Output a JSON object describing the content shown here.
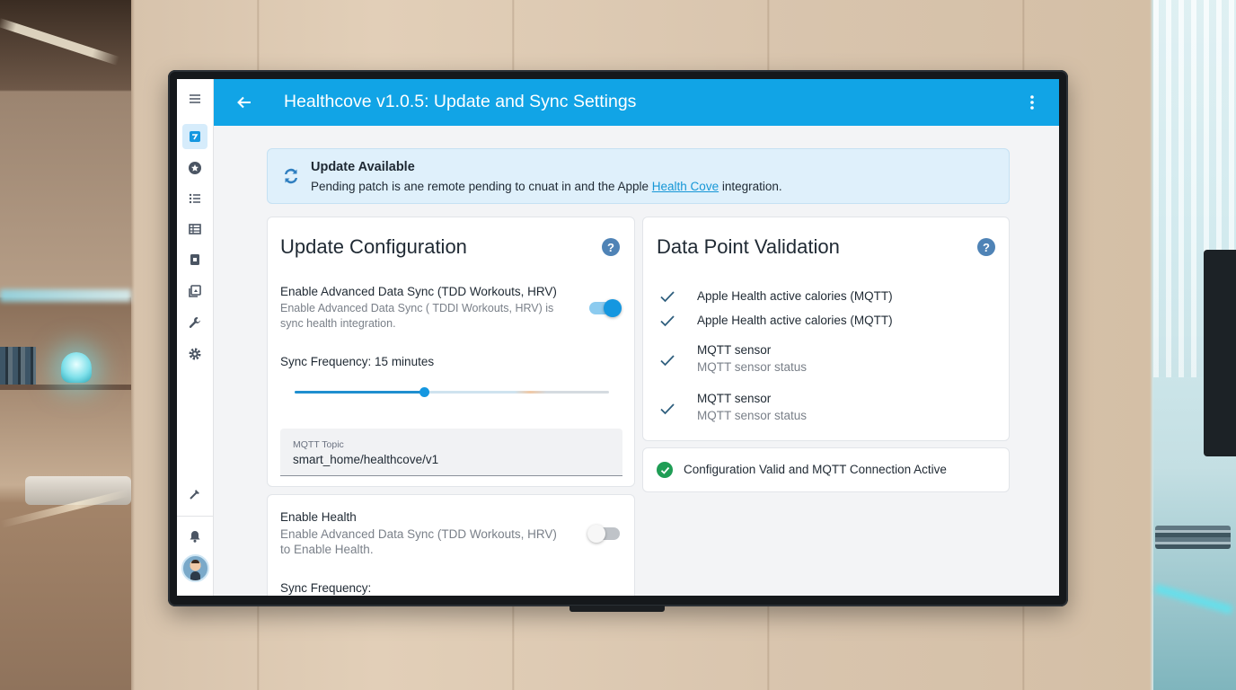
{
  "app": {
    "title": "Healthcove v1.0.5: Update and Sync Settings"
  },
  "sidebar": {
    "items": [
      {
        "icon": "menu-icon"
      },
      {
        "icon": "dashboard-icon",
        "active": true
      },
      {
        "icon": "star-badge-icon"
      },
      {
        "icon": "list-icon"
      },
      {
        "icon": "table-icon"
      },
      {
        "icon": "device-icon"
      },
      {
        "icon": "media-icon"
      },
      {
        "icon": "wrench-icon"
      },
      {
        "icon": "gear-icon"
      },
      {
        "icon": "hammer-icon"
      },
      {
        "icon": "bell-icon"
      },
      {
        "icon": "avatar"
      }
    ]
  },
  "banner": {
    "title": "Update Available",
    "text_before": "Pending patch is ane remote pending to cnuat in and the Apple ",
    "link": "Health Cove",
    "text_after": " integration."
  },
  "update_config": {
    "title": "Update Configuration",
    "advanced_sync_label": "Enable Advanced Data Sync (TDD Workouts, HRV)",
    "advanced_sync_desc": "Enable Advanced Data Sync ( TDDI Workouts, HRV) is sync health integration.",
    "advanced_sync_on": true,
    "sync_frequency_label": "Sync Frequency: 15 minutes",
    "sync_frequency_fraction": 0.41,
    "mqtt_topic_label": "MQTT Topic",
    "mqtt_topic_value": "smart_home/healthcove/v1"
  },
  "health_card": {
    "label": "Enable Health",
    "desc": "Enable Advanced Data Sync (TDD Workouts, HRV) to Enable Health.",
    "enabled": false,
    "sync_frequency_label": "Sync Frequency:"
  },
  "validation": {
    "title": "Data Point Validation",
    "items": [
      {
        "title": "Apple Health active calories (MQTT)",
        "subtitle": ""
      },
      {
        "title": "Apple Health active calories (MQTT)",
        "subtitle": ""
      },
      {
        "title": "MQTT sensor",
        "subtitle": "MQTT sensor status"
      },
      {
        "title": "MQTT sensor",
        "subtitle": "MQTT sensor status"
      }
    ],
    "status": "Configuration Valid and MQTT Connection Active"
  },
  "colors": {
    "accent": "#11a4e6",
    "success": "#1f9d55",
    "help": "#4f83b6"
  }
}
